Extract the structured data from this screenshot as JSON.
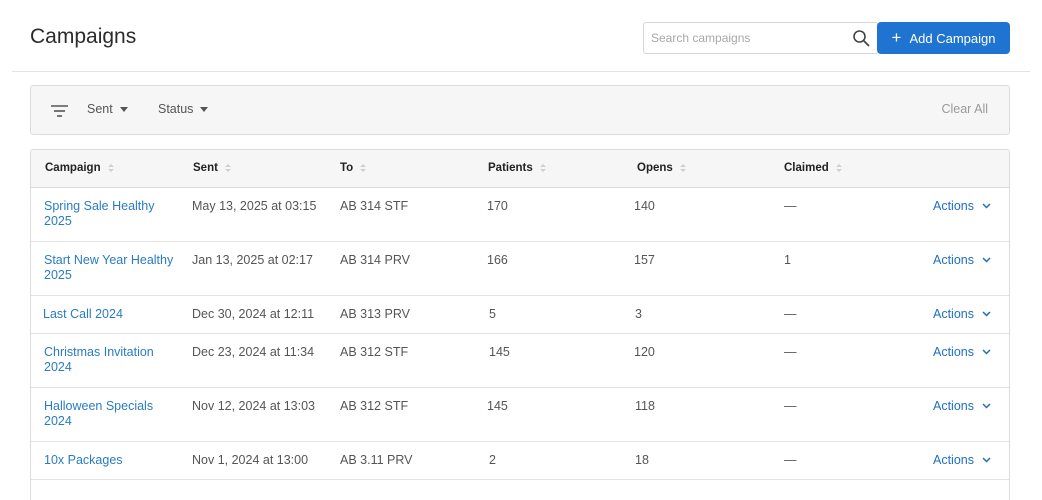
{
  "header": {
    "title": "Campaigns",
    "search_placeholder": "Search campaigns",
    "add_button_label": "Add Campaign"
  },
  "filters": {
    "sent_label": "Sent",
    "status_label": "Status",
    "clear_all_label": "Clear All"
  },
  "table": {
    "columns": [
      "Campaign",
      "Sent",
      "To",
      "Patients",
      "Opens",
      "Claimed"
    ],
    "rows": [
      {
        "campaign": [
          "Spring Sale Healthy",
          "2025"
        ],
        "sent": "May 13, 2025 at 03:15",
        "to": "AB 314 STF",
        "patients": "170",
        "opens": "140",
        "claimed": "—",
        "actions": "Actions"
      },
      {
        "campaign": [
          "Start New Year Healthy",
          "2025"
        ],
        "sent": "Jan 13, 2025 at 02:17",
        "to": "AB 314 PRV",
        "patients": "166",
        "opens": "157",
        "claimed": "1",
        "actions": "Actions"
      },
      {
        "campaign": [
          "Last Call 2024"
        ],
        "sent": "Dec 30, 2024 at 12:11",
        "to": "AB 313 PRV",
        "patients": "5",
        "opens": "3",
        "claimed": "—",
        "actions": "Actions"
      },
      {
        "campaign": [
          "Christmas Invitation",
          "2024"
        ],
        "sent": "Dec 23, 2024 at 11:34",
        "to": "AB 312 STF",
        "patients": "145",
        "opens": "120",
        "claimed": "—",
        "actions": "Actions"
      },
      {
        "campaign": [
          "Halloween Specials",
          "2024"
        ],
        "sent": "Nov 12, 2024 at 13:03",
        "to": "AB 312 STF",
        "patients": "145",
        "opens": "118",
        "claimed": "—",
        "actions": "Actions"
      },
      {
        "campaign": [
          "10x Packages"
        ],
        "sent": "Nov 1, 2024 at 13:00",
        "to": "AB 3.11 PRV",
        "patients": "2",
        "opens": "18",
        "claimed": "—",
        "actions": "Actions"
      }
    ]
  },
  "colors": {
    "accent": "#1e74d0",
    "link": "#2a7bc4"
  },
  "icons": {
    "search": "search-icon",
    "filter": "filter-icon",
    "plus": "plus-icon",
    "sort": "sort-icon",
    "chevron": "chevron-down-icon"
  }
}
